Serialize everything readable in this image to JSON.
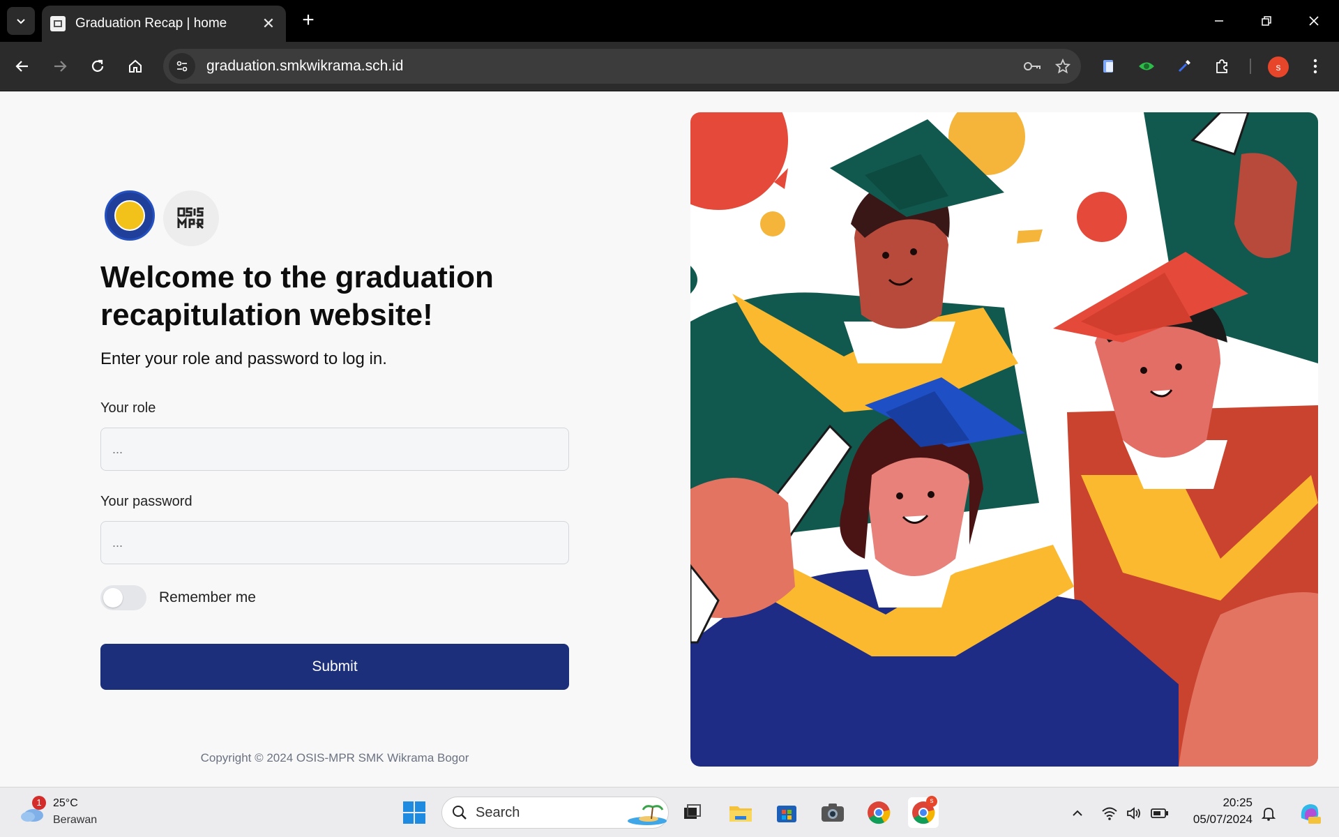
{
  "browser": {
    "tab_title": "Graduation Recap | home",
    "url": "graduation.smkwikrama.sch.id",
    "profile_initial": "s"
  },
  "page": {
    "logo_osis_text": "OSIS MPR",
    "welcome_title": "Welcome to the graduation recapitulation website!",
    "subtitle": "Enter your role and password to log in.",
    "role_label": "Your role",
    "role_placeholder": "...",
    "password_label": "Your password",
    "password_placeholder": "...",
    "remember_label": "Remember me",
    "remember_checked": false,
    "submit_label": "Submit",
    "copyright": "Copyright © 2024 OSIS-MPR SMK Wikrama Bogor"
  },
  "taskbar": {
    "weather_temp": "25°C",
    "weather_desc": "Berawan",
    "weather_badge": "1",
    "search_placeholder": "Search",
    "time": "20:25",
    "date": "05/07/2024",
    "chrome_badge": "s"
  },
  "colors": {
    "primary": "#1c2f7a",
    "page_bg": "#f8f8f8",
    "chrome_bg": "#2b2b2b"
  }
}
